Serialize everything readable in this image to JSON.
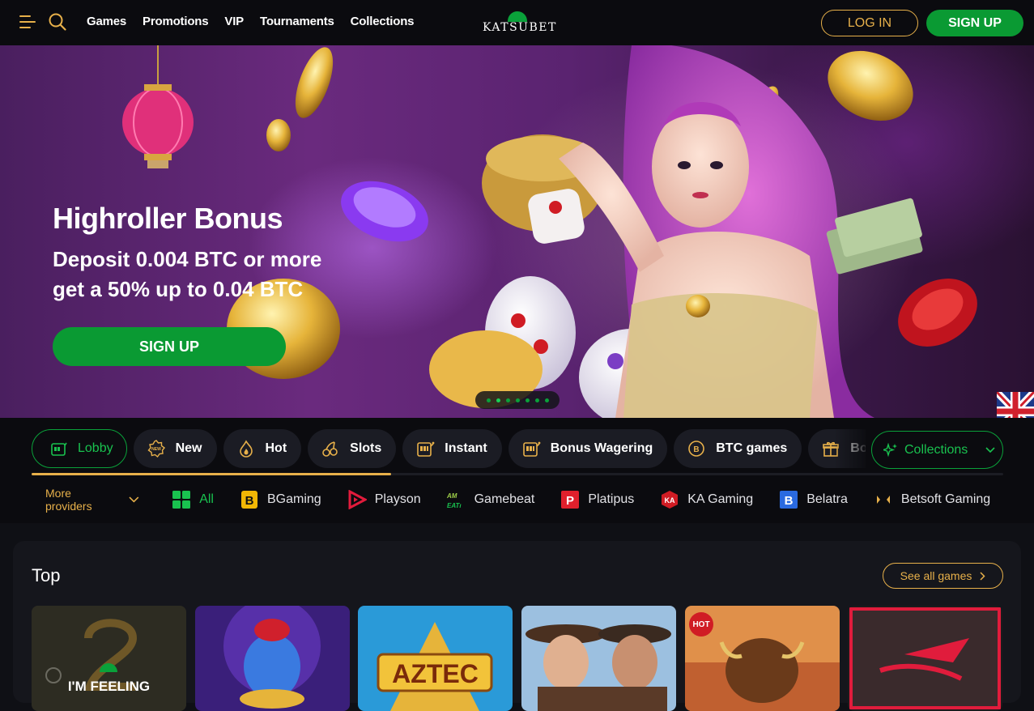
{
  "header": {
    "nav": [
      "Games",
      "Promotions",
      "VIP",
      "Tournaments",
      "Collections"
    ],
    "logo_text": "KATSUBET",
    "login_label": "LOG IN",
    "signup_label": "SIGN UP",
    "accent": "#e7b04a",
    "brand_green": "#0a9a33"
  },
  "hero": {
    "title": "Highroller Bonus",
    "subtitle": "Deposit 0.004 BTC or more get a 50% up to 0.04 BTC",
    "cta": "SIGN UP",
    "slides_total": 7,
    "active_slide": 2
  },
  "categories": {
    "items": [
      {
        "label": "Lobby",
        "icon": "lobby-icon",
        "active": true
      },
      {
        "label": "New",
        "icon": "new-badge-icon",
        "active": false
      },
      {
        "label": "Hot",
        "icon": "flame-icon",
        "active": false
      },
      {
        "label": "Slots",
        "icon": "cherries-icon",
        "active": false
      },
      {
        "label": "Instant",
        "icon": "slot-machine-icon",
        "active": false
      },
      {
        "label": "Bonus Wagering",
        "icon": "slot-machine-icon",
        "active": false
      },
      {
        "label": "BTC games",
        "icon": "bitcoin-icon",
        "active": false
      },
      {
        "label": "Bonu",
        "icon": "gift-icon",
        "active": false
      }
    ],
    "collections_label": "Collections",
    "scroll_progress": 0.37
  },
  "providers": {
    "more_label": "More providers",
    "items": [
      {
        "label": "All",
        "icon": "grid-icon",
        "active": true
      },
      {
        "label": "BGaming",
        "icon": "bgaming-logo-icon",
        "active": false
      },
      {
        "label": "Playson",
        "icon": "playson-logo-icon",
        "active": false
      },
      {
        "label": "Gamebeat",
        "icon": "gamebeat-logo-icon",
        "active": false
      },
      {
        "label": "Platipus",
        "icon": "platipus-logo-icon",
        "active": false
      },
      {
        "label": "KA Gaming",
        "icon": "ka-gaming-logo-icon",
        "active": false
      },
      {
        "label": "Belatra",
        "icon": "belatra-logo-icon",
        "active": false
      },
      {
        "label": "Betsoft Gaming",
        "icon": "betsoft-logo-icon",
        "active": false
      }
    ]
  },
  "top_games": {
    "title": "Top",
    "see_all_label": "See all games",
    "tiles": [
      {
        "name": "i-m-feeling-lucky",
        "caption": "I'M FEELING"
      },
      {
        "name": "genie-game",
        "caption": ""
      },
      {
        "name": "aztec-game",
        "caption": "AZTEC"
      },
      {
        "name": "cowboys-game",
        "caption": ""
      },
      {
        "name": "buffalo-game",
        "caption": "",
        "badge": "HOT"
      },
      {
        "name": "aviator-game",
        "caption": ""
      }
    ]
  }
}
